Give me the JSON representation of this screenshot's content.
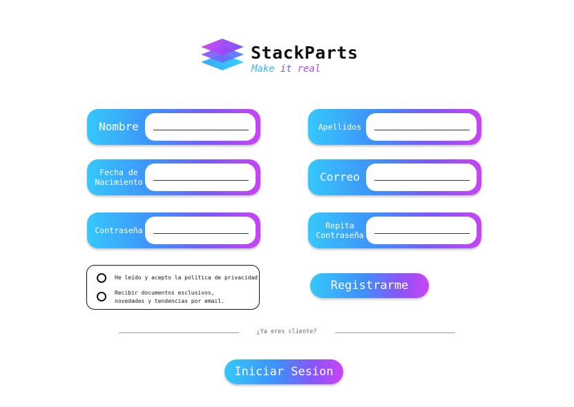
{
  "brand": {
    "name": "StackParts",
    "tagline": [
      "Make",
      "it",
      "real"
    ],
    "logo_icon": "stacked-layers-icon"
  },
  "fields": {
    "nombre": {
      "label": "Nombre",
      "value": ""
    },
    "apellidos": {
      "label": "Apellidos",
      "value": ""
    },
    "fecha": {
      "label_line1": "Fecha de",
      "label_line2": "Nacimiento",
      "value": ""
    },
    "correo": {
      "label": "Correo",
      "value": ""
    },
    "contrasena": {
      "label": "Contraseña",
      "value": ""
    },
    "repita": {
      "label_line1": "Repita",
      "label_line2": "Contraseña",
      "value": ""
    }
  },
  "checks": {
    "privacy": "He leído y acepto la política de privacidad",
    "newsletter_line1": "Recibir documentos esclusivos,",
    "newsletter_line2": "novedades y tendencias por email."
  },
  "buttons": {
    "register": "Registrarme",
    "login": "Iniciar Sesion"
  },
  "divider_text": "¿Ya eres cliente?",
  "colors": {
    "gradient_start": "#35c8fb",
    "gradient_mid": "#3f8ff9",
    "gradient_end": "#c844f5"
  }
}
